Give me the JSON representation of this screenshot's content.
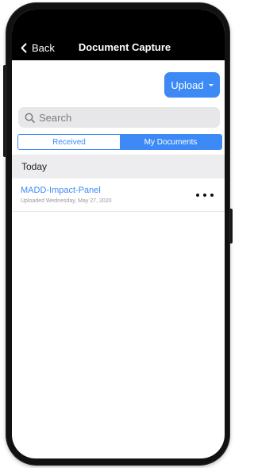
{
  "navbar": {
    "back_label": "Back",
    "title": "Document Capture"
  },
  "toolbar": {
    "upload_label": "Upload"
  },
  "search": {
    "placeholder": "Search"
  },
  "segments": {
    "received_label": "Received",
    "my_documents_label": "My Documents",
    "selected": "My Documents"
  },
  "section": {
    "header": "Today"
  },
  "documents": [
    {
      "title": "MADD-Impact-Panel",
      "subtitle": "Uploaded Wednesday, May 27, 2020"
    }
  ],
  "colors": {
    "accent": "#3d8af7",
    "navbar_bg": "#000000",
    "section_bg": "#ededef",
    "search_bg": "#e7e7e9"
  },
  "icons": {
    "back": "chevron-left-icon",
    "search": "search-icon",
    "upload_menu": "caret-down-icon",
    "more": "more-horizontal-icon"
  }
}
